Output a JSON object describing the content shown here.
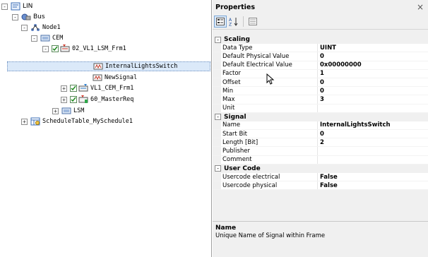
{
  "tree": {
    "nodes": [
      {
        "label": "LIN",
        "icon": "lin-cluster-icon",
        "expander": "-"
      },
      {
        "label": "Bus",
        "icon": "bus-icon",
        "expander": "-"
      },
      {
        "label": "Node1",
        "icon": "node-icon",
        "expander": "-"
      },
      {
        "label": "CEM",
        "icon": "ecu-icon",
        "expander": "-"
      },
      {
        "label": "02_VL1_LSM_Frm1",
        "icon": "frame-rx-icon",
        "expander": "-",
        "checked": true
      },
      {
        "label": "InternalLightsSwitch",
        "icon": "signal-icon",
        "selected": true
      },
      {
        "label": "NewSignal",
        "icon": "signal-icon"
      },
      {
        "label": "VL1_CEM_Frm1",
        "icon": "frame-tx-icon",
        "expander": "+",
        "checked": true
      },
      {
        "label": "60_MasterReq",
        "icon": "frame-rx-icon",
        "expander": "+",
        "checked": true
      },
      {
        "label": "LSM",
        "icon": "ecu-icon",
        "expander": "+"
      },
      {
        "label": "ScheduleTable_MySchedule1",
        "icon": "schedule-table-icon",
        "expander": "+"
      }
    ]
  },
  "properties": {
    "title": "Properties",
    "close_glyph": "×",
    "toolbar": {
      "categorized_icon": "categorized-view-icon",
      "alphabetical_icon": "sort-alphabetical-icon",
      "property_pages_icon": "property-pages-icon"
    },
    "categories": [
      {
        "label": "Scaling",
        "expander": "-",
        "rows": [
          {
            "name": "Data Type",
            "value": "UINT"
          },
          {
            "name": "Default Physical Value",
            "value": "0"
          },
          {
            "name": "Default Electrical Value",
            "value": "0x00000000"
          },
          {
            "name": "Factor",
            "value": "1"
          },
          {
            "name": "Offset",
            "value": "0"
          },
          {
            "name": "Min",
            "value": "0"
          },
          {
            "name": "Max",
            "value": "3"
          },
          {
            "name": "Unit",
            "value": ""
          }
        ]
      },
      {
        "label": "Signal",
        "expander": "-",
        "rows": [
          {
            "name": "Name",
            "value": "InternalLightsSwitch"
          },
          {
            "name": "Start Bit",
            "value": "0"
          },
          {
            "name": "Length [Bit]",
            "value": "2"
          },
          {
            "name": "Publisher",
            "value": ""
          },
          {
            "name": "Comment",
            "value": ""
          }
        ]
      },
      {
        "label": "User Code",
        "expander": "-",
        "rows": [
          {
            "name": "Usercode electrical",
            "value": "False"
          },
          {
            "name": "Usercode physical",
            "value": "False"
          }
        ]
      }
    ],
    "description": {
      "title": "Name",
      "text": "Unique Name of Signal within Frame"
    }
  }
}
